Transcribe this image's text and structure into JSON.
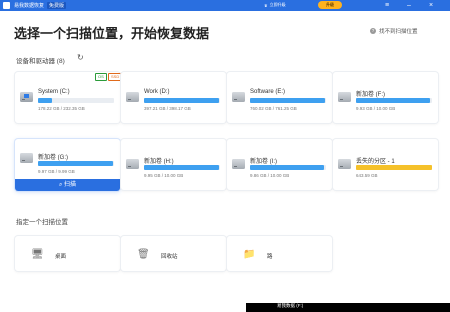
{
  "app": {
    "name": "易我数据恢复",
    "version": "免费版",
    "upgrade_link": "立即升级",
    "upgrade_button": "升级"
  },
  "heading": "选择一个扫描位置，开始恢复数据",
  "help_link": "找不到扫描位置",
  "devices_section": "设备和驱动器 (8)",
  "drives": [
    {
      "name": "System (C:)",
      "size": "178.22 GB / 232.35 GB",
      "fill": 0.18,
      "os_badge": "OS",
      "ssd_badge": "SSD",
      "icon": "windows-drive-icon"
    },
    {
      "name": "Work (D:)",
      "size": "397.21 GB / 398.17 GB",
      "fill": 0.99,
      "icon": "hard-drive-icon"
    },
    {
      "name": "Software (E:)",
      "size": "760.02 GB / 761.25 GB",
      "fill": 0.99,
      "icon": "hard-drive-icon"
    },
    {
      "name": "新加卷 (F:)",
      "size": "9.93 GB / 10.00 GB",
      "fill": 0.98,
      "icon": "hard-drive-icon"
    },
    {
      "name": "新加卷 (G:)",
      "size": "9.97 GB / 9.99 GB",
      "fill": 0.99,
      "icon": "hard-drive-icon",
      "scan_label": "扫描"
    },
    {
      "name": "新加卷 (H:)",
      "size": "9.95 GB / 10.00 GB",
      "fill": 0.99,
      "icon": "hard-drive-icon"
    },
    {
      "name": "新加卷 (I:)",
      "size": "9.86 GB / 10.00 GB",
      "fill": 0.98,
      "icon": "hard-drive-icon"
    },
    {
      "name": "丢失的分区 - 1",
      "size": "643.59 GB",
      "fill": 1.0,
      "icon": "lost-partition-icon"
    }
  ],
  "locations_section": "指定一个扫描位置",
  "locations": [
    {
      "label": "桌面",
      "icon": "desktop-icon"
    },
    {
      "label": "回收站",
      "icon": "recycle-bin-icon"
    },
    {
      "label": "路",
      "icon": "folder-icon"
    }
  ],
  "bottom_text": "易我数据 (F:)",
  "colors": {
    "accent": "#2a6fe0",
    "bar": "#3ea0f0",
    "lost": "#f5c12a"
  }
}
